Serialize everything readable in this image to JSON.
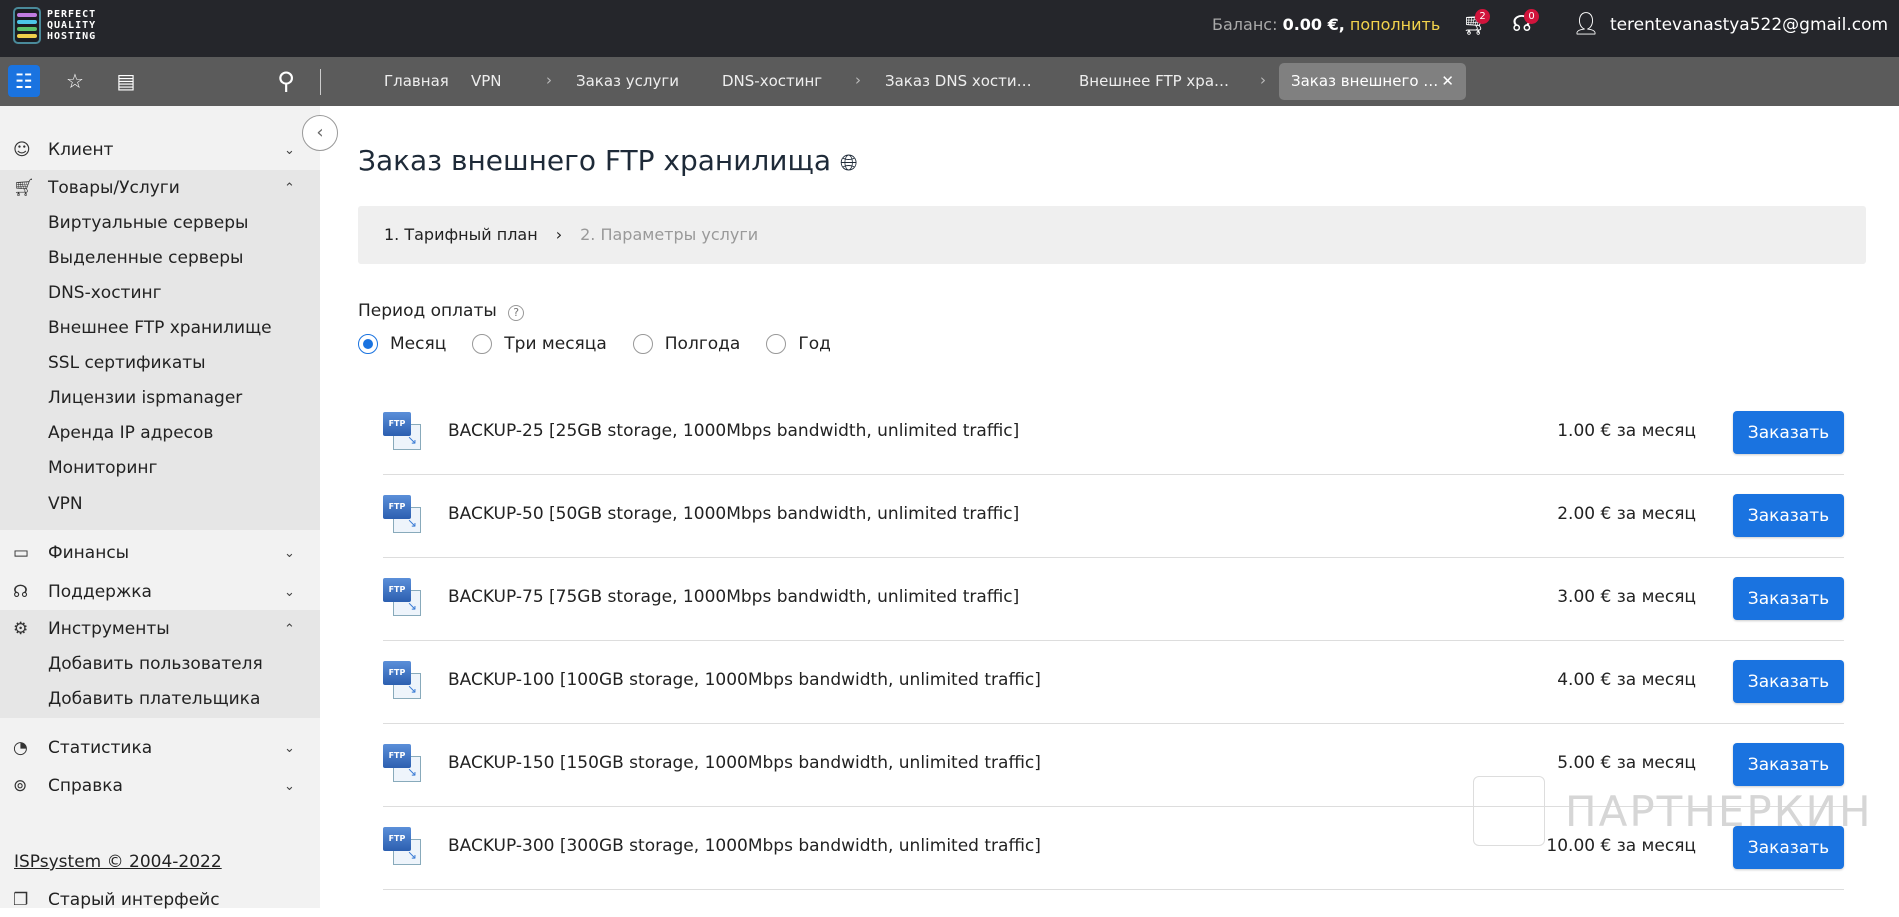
{
  "header": {
    "logo_text": "PERFECT QUALITY HOSTING",
    "balance_label": "Баланс:",
    "balance_value": "0.00 €,",
    "topup": "пополнить",
    "cart_count": "2",
    "support_count": "0",
    "user_email": "terentevanastya522@gmail.com"
  },
  "breadcrumbs": [
    "Главная",
    "VPN",
    "Заказ услуги",
    "DNS-хостинг",
    "Заказ DNS хости…",
    "Внешнее FTP хра…"
  ],
  "active_tab": "Заказ внешнего …",
  "sidebar": {
    "items": [
      {
        "label": "Клиент",
        "icon": "user-icon"
      },
      {
        "label": "Товары/Услуги",
        "icon": "cart-icon"
      },
      {
        "label": "Финансы",
        "icon": "wallet-icon"
      },
      {
        "label": "Поддержка",
        "icon": "headset-icon"
      },
      {
        "label": "Инструменты",
        "icon": "gear-icon"
      },
      {
        "label": "Статистика",
        "icon": "pie-icon"
      },
      {
        "label": "Справка",
        "icon": "lifebuoy-icon"
      }
    ],
    "products_sub": [
      "Виртуальные серверы",
      "Выделенные серверы",
      "DNS-хостинг",
      "Внешнее FTP хранилище",
      "SSL сертификаты",
      "Лицензии ispmanager",
      "Аренда IP адресов",
      "Мониторинг",
      "VPN"
    ],
    "tools_sub": [
      "Добавить пользователя",
      "Добавить плательщика"
    ],
    "copyright": "ISPsystem © 2004-2022",
    "old_interface": "Старый интерфейс"
  },
  "page": {
    "title": "Заказ внешнего FTP хранилища",
    "step1": "1. Тарифный план",
    "step2": "2. Параметры услуги",
    "period_label": "Период оплаты",
    "periods": [
      "Месяц",
      "Три месяца",
      "Полгода",
      "Год"
    ],
    "selected_period": "Месяц",
    "order_label": "Заказать",
    "plans": [
      {
        "name": "BACKUP-25 [25GB storage, 1000Mbps bandwidth, unlimited traffic]",
        "price": "1.00 € за месяц"
      },
      {
        "name": "BACKUP-50 [50GB storage, 1000Mbps bandwidth, unlimited traffic]",
        "price": "2.00 € за месяц"
      },
      {
        "name": "BACKUP-75 [75GB storage, 1000Mbps bandwidth, unlimited traffic]",
        "price": "3.00 € за месяц"
      },
      {
        "name": "BACKUP-100 [100GB storage, 1000Mbps bandwidth, unlimited traffic]",
        "price": "4.00 € за месяц"
      },
      {
        "name": "BACKUP-150 [150GB storage, 1000Mbps bandwidth, unlimited traffic]",
        "price": "5.00 € за месяц"
      },
      {
        "name": "BACKUP-300 [300GB storage, 1000Mbps bandwidth, unlimited traffic]",
        "price": "10.00 € за месяц"
      }
    ]
  },
  "watermark": "ПАРТНЕРКИН",
  "colors": {
    "accent": "#1a73e0",
    "topbar": "#25262b",
    "toolbar": "#5b5b5b",
    "topup": "#f2d34c"
  }
}
